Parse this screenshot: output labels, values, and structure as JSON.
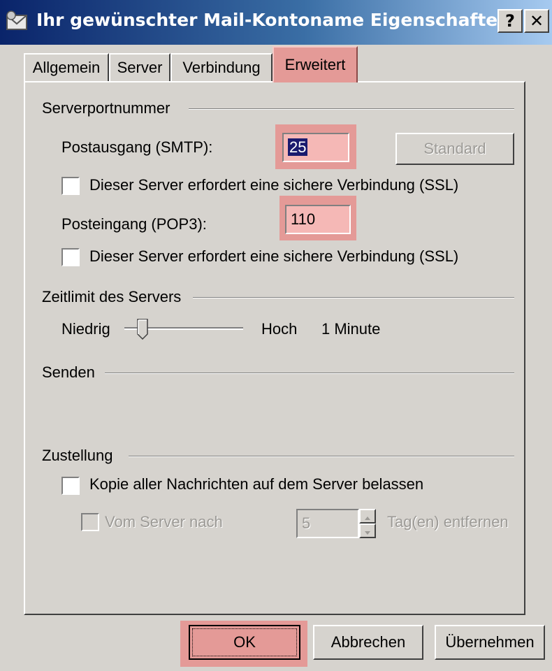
{
  "window": {
    "title": "Ihr gewünschter Mail-Kontoname Eigenschaften",
    "help_label": "?",
    "close_label": "✕"
  },
  "tabs": [
    {
      "label": "Allgemein",
      "active": false
    },
    {
      "label": "Server",
      "active": false
    },
    {
      "label": "Verbindung",
      "active": false
    },
    {
      "label": "Erweitert",
      "active": true
    }
  ],
  "serverports": {
    "group_label": "Serverportnummer",
    "smtp_label": "Postausgang (SMTP):",
    "smtp_value": "25",
    "standard_label": "Standard",
    "smtp_ssl_label": "Dieser Server erfordert eine sichere Verbindung (SSL)",
    "smtp_ssl_checked": false,
    "pop3_label": "Posteingang (POP3):",
    "pop3_value": "110",
    "pop3_ssl_label": "Dieser Server erfordert eine sichere Verbindung (SSL)",
    "pop3_ssl_checked": false
  },
  "timeout": {
    "group_label": "Zeitlimit des Servers",
    "low_label": "Niedrig",
    "high_label": "Hoch",
    "value_label": "1 Minute",
    "slider_position": 0.2
  },
  "send": {
    "group_label": "Senden"
  },
  "delivery": {
    "group_label": "Zustellung",
    "keep_copy_label": "Kopie aller Nachrichten auf dem Server belassen",
    "keep_copy_checked": false,
    "remove_after_label": "Vom Server nach",
    "remove_after_days": "5",
    "days_label": "Tag(en) entfernen"
  },
  "footer": {
    "ok_label": "OK",
    "cancel_label": "Abbrechen",
    "apply_label": "Übernehmen"
  },
  "colors": {
    "highlight": "#e49a97",
    "titlebar_start": "#0a246a",
    "titlebar_end": "#a6caf0",
    "dialog_face": "#d6d3ce"
  }
}
